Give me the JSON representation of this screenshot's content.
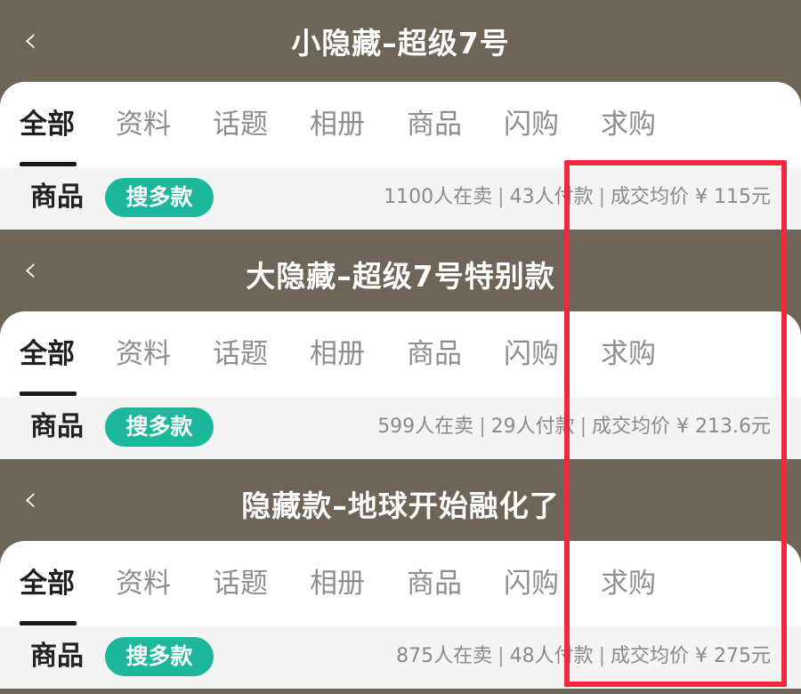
{
  "panels": [
    {
      "title": "小隐藏–超级7号",
      "tabs": [
        "全部",
        "资料",
        "话题",
        "相册",
        "商品",
        "闪购",
        "求购"
      ],
      "section_label": "商品",
      "pill_label": "搜多款",
      "sellers": "1100人在卖",
      "payers": "43人付款",
      "avg_price": "成交均价 ¥ 115元"
    },
    {
      "title": "大隐藏–超级7号特别款",
      "tabs": [
        "全部",
        "资料",
        "话题",
        "相册",
        "商品",
        "闪购",
        "求购"
      ],
      "section_label": "商品",
      "pill_label": "搜多款",
      "sellers": "599人在卖",
      "payers": "29人付款",
      "avg_price": "成交均价 ¥ 213.6元"
    },
    {
      "title": "隐藏款–地球开始融化了",
      "tabs": [
        "全部",
        "资料",
        "话题",
        "相册",
        "商品",
        "闪购",
        "求购"
      ],
      "section_label": "商品",
      "pill_label": "搜多款",
      "sellers": "875人在卖",
      "payers": "48人付款",
      "avg_price": "成交均价 ¥ 275元"
    }
  ],
  "back_glyph": "‹",
  "separator": "|",
  "colors": {
    "header_bg": "#6e6558",
    "pill_bg": "#1db79b",
    "highlight": "#f0283e"
  }
}
